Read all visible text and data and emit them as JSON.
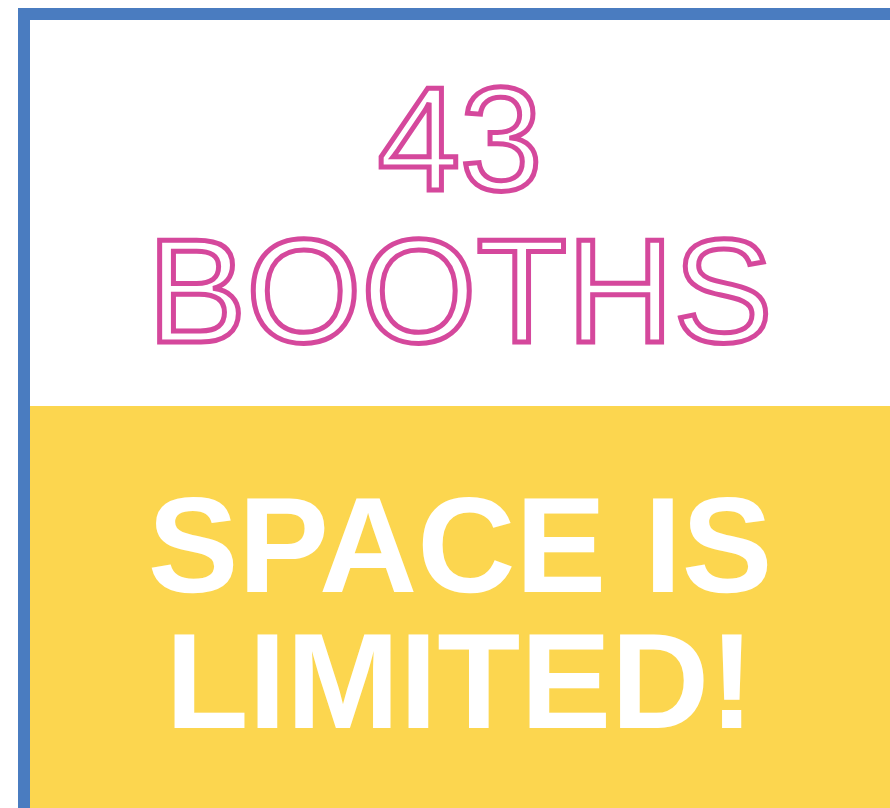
{
  "headline": {
    "count": "43",
    "label": "BOOTHS"
  },
  "banner": {
    "lines": [
      "SPACE IS",
      "LIMITED!"
    ]
  }
}
